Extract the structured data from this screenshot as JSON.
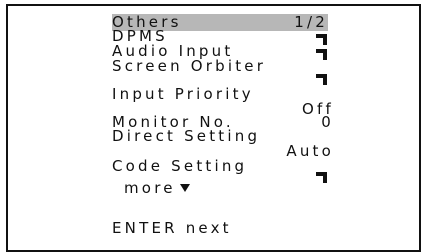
{
  "menu": {
    "title": "Others",
    "page": "1/2",
    "items": [
      {
        "label": "DPMS",
        "value": ""
      },
      {
        "label": "Audio Input",
        "value": ""
      },
      {
        "label": "Screen Orbiter",
        "value": ""
      },
      {
        "label": "Input Priority",
        "value": "Off"
      },
      {
        "label": "Monitor No.",
        "value": "0"
      },
      {
        "label": "Direct Setting",
        "value": "Auto"
      },
      {
        "label": "Code Setting",
        "value": ""
      }
    ],
    "more_label": "more",
    "footer": "ENTER next"
  }
}
